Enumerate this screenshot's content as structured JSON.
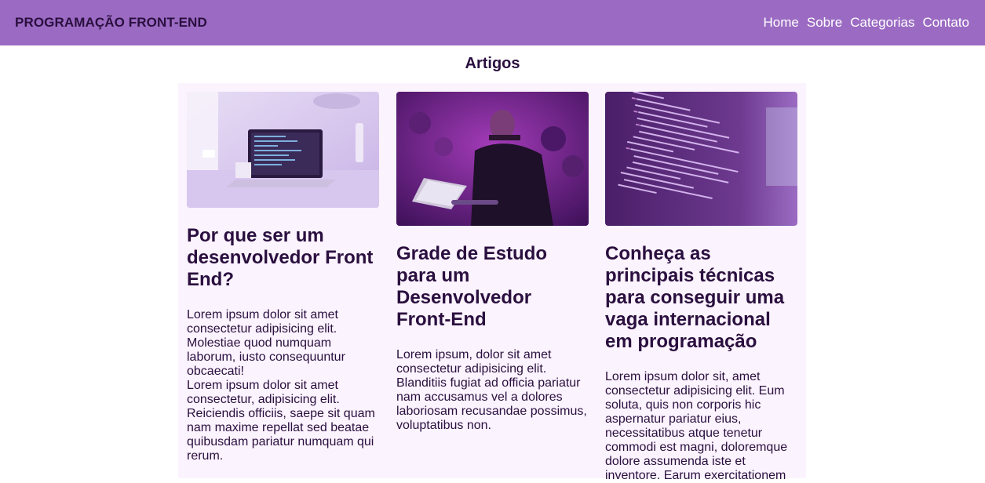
{
  "header": {
    "brand": "PROGRAMAÇÃO FRONT-END",
    "nav": [
      "Home",
      "Sobre",
      "Categorias",
      "Contato"
    ]
  },
  "section_title": "Artigos",
  "articles": [
    {
      "image": "laptop-desk-photo",
      "title": "Por que ser um desenvolvedor Front End?",
      "paragraphs": [
        "Lorem ipsum dolor sit amet consectetur adipisicing elit. Molestiae quod numquam laborum, iusto consequuntur obcaecati!",
        "Lorem ipsum dolor sit amet consectetur, adipisicing elit. Reiciendis officiis, saepe sit quam nam maxime repellat sed beatae quibusdam pariatur numquam qui rerum."
      ]
    },
    {
      "image": "developer-coding-event-photo",
      "title": "Grade de Estudo para um Desenvolvedor Front-End",
      "paragraphs": [
        "Lorem ipsum, dolor sit amet consectetur adipisicing elit. Blanditiis fugiat ad officia pariatur nam accusamus vel a dolores laboriosam recusandae possimus, voluptatibus non."
      ]
    },
    {
      "image": "code-screen-photo",
      "title": "Conheça as principais técnicas para conseguir uma vaga internacional em programação",
      "paragraphs": [
        "Lorem ipsum dolor sit, amet consectetur adipisicing elit. Eum soluta, quis non corporis hic aspernatur pariatur eius, necessitatibus atque tenetur commodi est magni, doloremque dolore assumenda iste et inventore. Earum exercitationem"
      ]
    }
  ],
  "colors": {
    "header_bg": "#9b6bc3",
    "text": "#2a0f3f",
    "card_bg": "#fbf3fd"
  }
}
